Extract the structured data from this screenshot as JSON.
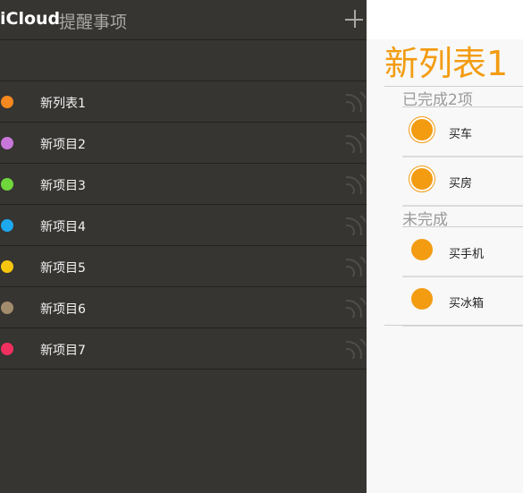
{
  "header": {
    "brand": "iCloud",
    "title": "提醒事项"
  },
  "sidebar": {
    "lists": [
      {
        "name": "新列表1",
        "color": "#f5891f"
      },
      {
        "name": "新项目2",
        "color": "#c877d8"
      },
      {
        "name": "新项目3",
        "color": "#6fd63c"
      },
      {
        "name": "新项目4",
        "color": "#1ea9ef"
      },
      {
        "name": "新项目5",
        "color": "#f6c60f"
      },
      {
        "name": "新项目6",
        "color": "#a38c6c"
      },
      {
        "name": "新项目7",
        "color": "#f0305e"
      }
    ]
  },
  "detail": {
    "title": "新列表1",
    "completed_label": "已完成2项",
    "completed_items": [
      "买车",
      "买房"
    ],
    "pending_label": "未完成",
    "pending_items": [
      "买手机",
      "买冰箱"
    ],
    "accent": "#f39c12"
  }
}
